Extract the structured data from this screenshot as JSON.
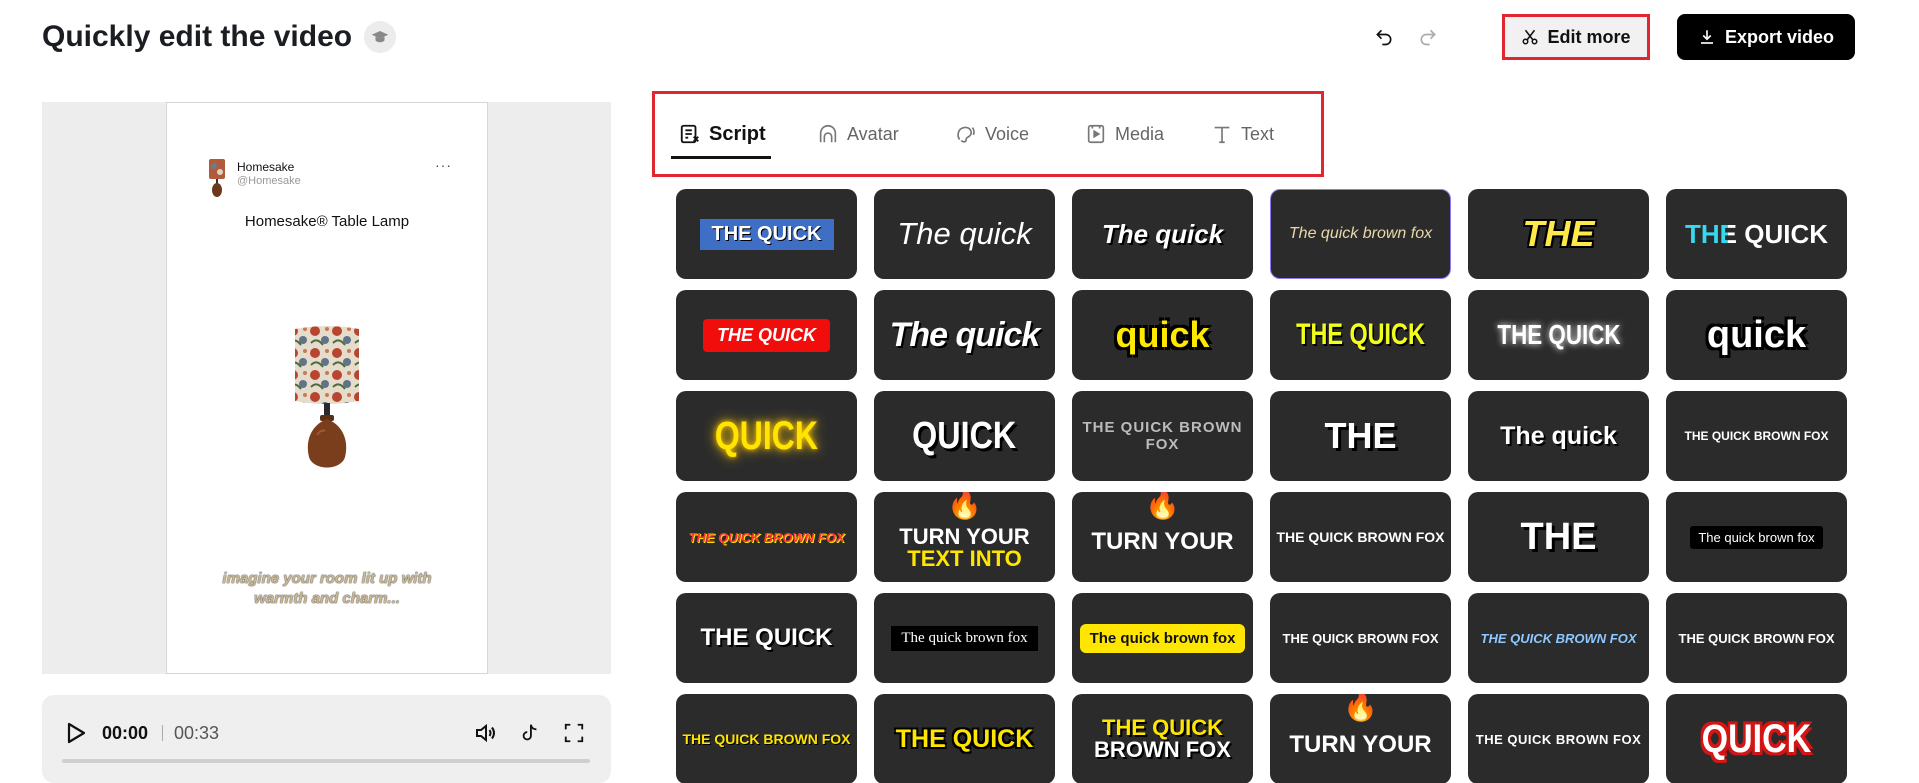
{
  "header": {
    "title": "Quickly edit the video",
    "edit_more_label": "Edit more",
    "export_label": "Export video"
  },
  "preview": {
    "account_name": "Homesake",
    "account_handle": "@Homesake",
    "more": "···",
    "product_title": "Homesake® Table Lamp",
    "caption": "imagine your room lit up with warmth and charm..."
  },
  "player": {
    "current_time": "00:00",
    "total_time": "00:33",
    "progress": 0
  },
  "tabs": [
    {
      "label": "Script",
      "icon": "script-icon",
      "active": true
    },
    {
      "label": "Avatar",
      "icon": "avatar-icon",
      "active": false
    },
    {
      "label": "Voice",
      "icon": "voice-icon",
      "active": false
    },
    {
      "label": "Media",
      "icon": "media-icon",
      "active": false
    },
    {
      "label": "Text",
      "icon": "text-icon",
      "active": false
    }
  ],
  "caption_styles": [
    {
      "line1": "THE QUICK",
      "line2": ""
    },
    {
      "line1": "The quick",
      "line2": ""
    },
    {
      "line1": "The quick",
      "line2": ""
    },
    {
      "line1": "The quick brown fox",
      "line2": ""
    },
    {
      "line1": "THE",
      "line2": ""
    },
    {
      "line1": "THE QUICK",
      "line2": ""
    },
    {
      "line1": "THE QUICK",
      "line2": ""
    },
    {
      "line1": "The quick",
      "line2": ""
    },
    {
      "line1": "quick",
      "line2": ""
    },
    {
      "line1": "THE QUICK",
      "line2": ""
    },
    {
      "line1": "THE QUICK",
      "line2": ""
    },
    {
      "line1": "quick",
      "line2": ""
    },
    {
      "line1": "QUICK",
      "line2": ""
    },
    {
      "line1": "QUICK",
      "line2": ""
    },
    {
      "line1": "THE QUICK BROWN FOX",
      "line2": ""
    },
    {
      "line1": "THE",
      "line2": ""
    },
    {
      "line1": "The quick",
      "line2": ""
    },
    {
      "line1": "THE QUICK BROWN FOX",
      "line2": ""
    },
    {
      "line1": "THE QUICK BROWN FOX",
      "line2": ""
    },
    {
      "line1": "TURN YOUR",
      "line2": "TEXT INTO"
    },
    {
      "line1": "TURN YOUR",
      "line2": ""
    },
    {
      "line1": "THE QUICK BROWN FOX",
      "line2": ""
    },
    {
      "line1": "THE",
      "line2": ""
    },
    {
      "line1": "The quick brown fox",
      "line2": ""
    },
    {
      "line1": "THE QUICK",
      "line2": ""
    },
    {
      "line1": "The quick brown fox",
      "line2": ""
    },
    {
      "line1": "The quick brown fox",
      "line2": ""
    },
    {
      "line1": "THE QUICK BROWN FOX",
      "line2": ""
    },
    {
      "line1": "THE QUICK BROWN FOX",
      "line2": ""
    },
    {
      "line1": "THE QUICK BROWN FOX",
      "line2": ""
    },
    {
      "line1": "THE QUICK BROWN FOX",
      "line2": ""
    },
    {
      "line1": "THE QUICK",
      "line2": ""
    },
    {
      "line1": "THE QUICK",
      "line2": "BROWN FOX"
    },
    {
      "line1": "TURN YOUR",
      "line2": ""
    },
    {
      "line1": "THE QUICK BROWN FOX",
      "line2": ""
    },
    {
      "line1": "QUICK",
      "line2": ""
    }
  ],
  "selected_style_index": 3
}
